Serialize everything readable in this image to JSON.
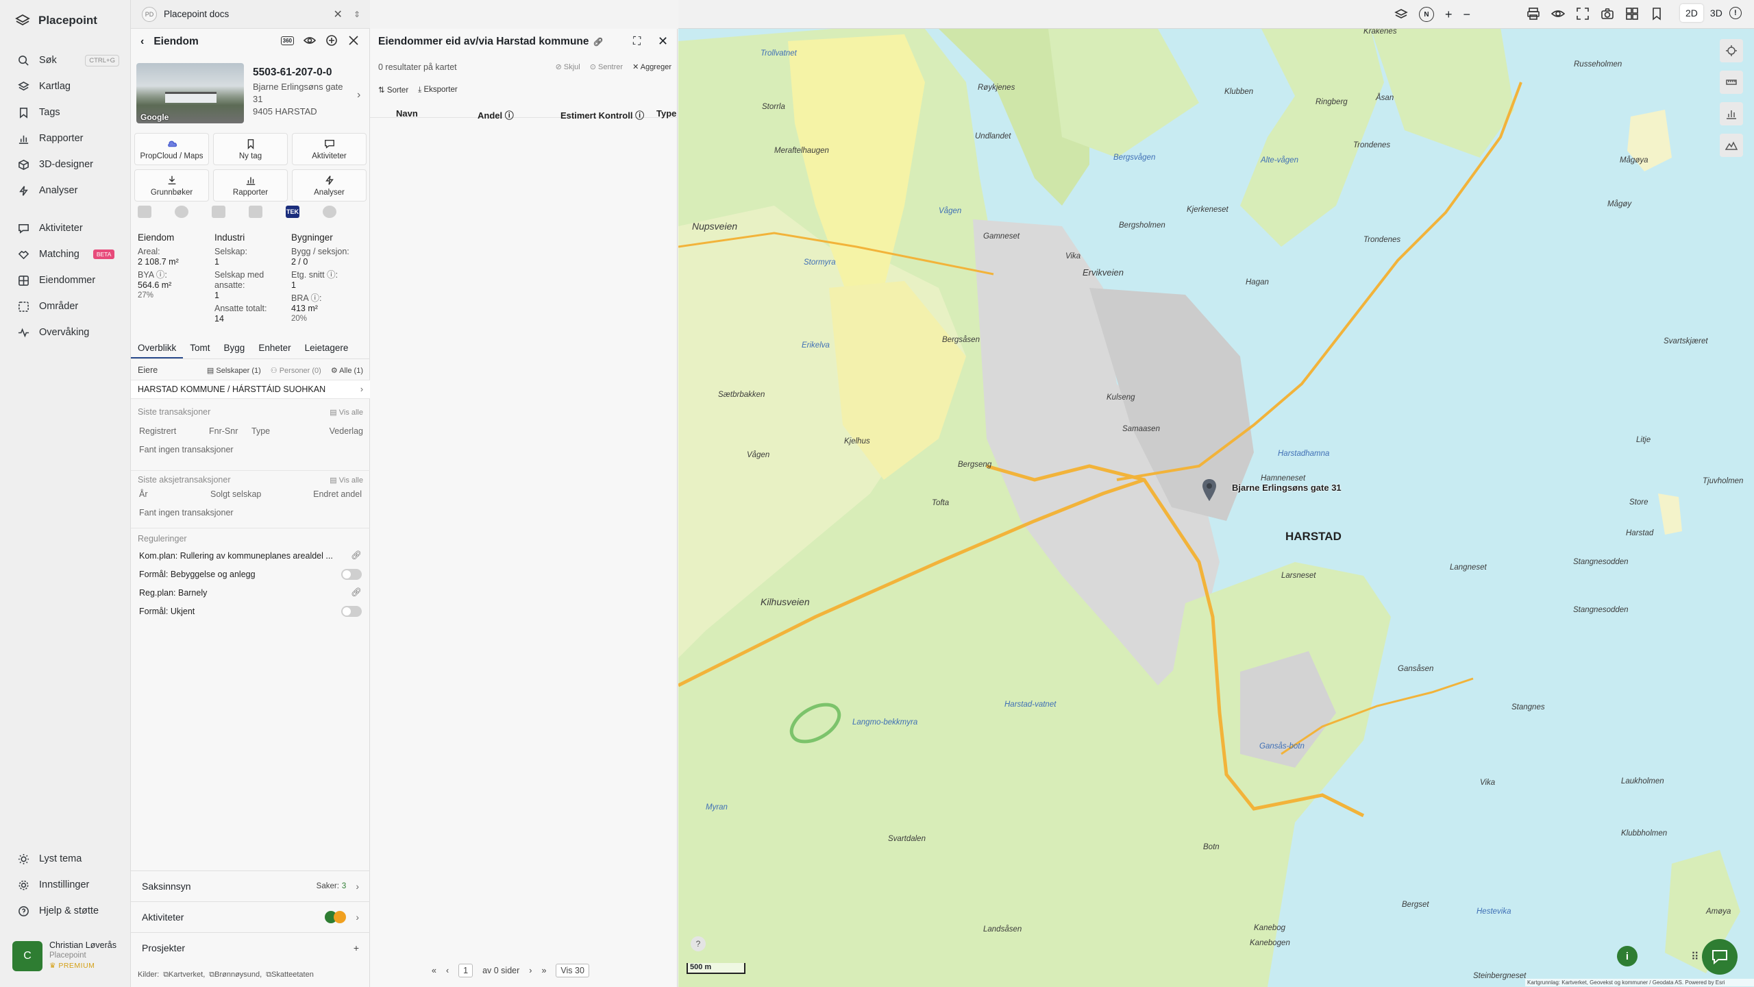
{
  "app": {
    "name": "Placepoint"
  },
  "nav": {
    "search": "Søk",
    "search_shortcut": "CTRL+G",
    "map_layers": "Kartlag",
    "tags": "Tags",
    "reports": "Rapporter",
    "designer3d": "3D-designer",
    "analyses": "Analyser",
    "activities": "Aktiviteter",
    "matching": "Matching",
    "matching_badge": "BETA",
    "properties": "Eiendommer",
    "areas": "Områder",
    "monitoring": "Overvåking",
    "theme": "Lyst tema",
    "settings": "Innstillinger",
    "help": "Hjelp & støtte"
  },
  "user": {
    "initial": "C",
    "name": "Christian Løverås",
    "org": "Placepoint",
    "plan": "PREMIUM"
  },
  "docs_tab": {
    "icon": "PD",
    "label": "Placepoint docs"
  },
  "property_panel": {
    "title": "Eiendom",
    "badge": "360",
    "photo_credit": "Google",
    "property_id": "5503-61-207-0-0",
    "address_line1": "Bjarne Erlingsøns gate 31",
    "address_line2": "9405 HARSTAD",
    "quick_actions": [
      "PropCloud / Maps",
      "Ny tag",
      "Aktiviteter",
      "Grunnbøker",
      "Rapporter",
      "Analyser"
    ],
    "source_icon_tek": "TEK",
    "stats": {
      "eiendom": {
        "heading": "Eiendom",
        "area_label": "Areal:",
        "area_value": "2 108.7 m²",
        "bya_label": "BYA ⓘ:",
        "bya_value": "564.6 m²",
        "bya_pct": "27%"
      },
      "industri": {
        "heading": "Industri",
        "companies_label": "Selskap:",
        "companies_value": "1",
        "with_employees_label": "Selskap med ansatte:",
        "with_employees_value": "1",
        "employees_label": "Ansatte totalt:",
        "employees_value": "14"
      },
      "bygninger": {
        "heading": "Bygninger",
        "bygg_label": "Bygg / seksjon:",
        "bygg_value": "2 / 0",
        "etg_label": "Etg. snitt ⓘ:",
        "etg_value": "1",
        "bra_label": "BRA ⓘ:",
        "bra_value": "413 m²",
        "bra_pct": "20%"
      }
    },
    "tabs": [
      "Overblikk",
      "Tomt",
      "Bygg",
      "Enheter",
      "Leietagere"
    ],
    "owners": {
      "label": "Eiere",
      "companies": "Selskaper (1)",
      "persons": "Personer (0)",
      "all": "Alle (1)",
      "owner_name": "HARSTAD KOMMUNE / HÁRSTTÁID SUOHKAN"
    },
    "transactions": {
      "title": "Siste transaksjoner",
      "see_all": "Vis alle",
      "cols": [
        "Registrert",
        "Fnr-Snr",
        "Type",
        "Vederlag"
      ],
      "empty": "Fant ingen transaksjoner"
    },
    "share_transactions": {
      "title": "Siste aksjetransaksjoner",
      "see_all": "Vis alle",
      "cols": [
        "År",
        "Solgt selskap",
        "Endret andel"
      ],
      "empty": "Fant ingen transaksjoner"
    },
    "regulations": {
      "title": "Reguleringer",
      "items": [
        "Kom.plan: Rullering av kommuneplanes arealdel ...",
        "Formål: Bebyggelse og anlegg",
        "Reg.plan: Barnely",
        "Formål: Ukjent"
      ]
    },
    "case_insight": {
      "label": "Saksinnsyn",
      "count_label": "Saker:",
      "count": "3"
    },
    "activities": {
      "label": "Aktiviteter"
    },
    "projects": {
      "label": "Prosjekter",
      "add": "+"
    },
    "sources": {
      "label": "Kilder:",
      "items": [
        "Kartverket",
        "Brønnøysund",
        "Skatteetaten"
      ]
    }
  },
  "owned_panel": {
    "title": "Eiendommer eid av/via Harstad kommune",
    "result_text": "0 resultater på kartet",
    "hide": "Skjul",
    "center": "Sentrer",
    "aggregate": "Aggreger",
    "sort": "Sorter",
    "export": "Eksporter",
    "columns": [
      "Navn",
      "Andel ⓘ",
      "Estimert Kontroll ⓘ",
      "Type"
    ],
    "pager": {
      "page": "1",
      "of_pages": "av 0 sider",
      "per_page": "Vis 30"
    }
  },
  "map": {
    "mode_2d": "2D",
    "mode_3d": "3D",
    "marker_label": "Bjarne Erlingsøns gate 31",
    "town": "HARSTAD",
    "scale": "500 m",
    "attribution": "Kartgrunnlag: Kartverket, Geovekst og kommuner / Geodata AS. Powered by Esri",
    "labels": [
      "Trollvatnet",
      "Krakenes",
      "Klubben",
      "Ringberg",
      "Åsan",
      "Russeholmen",
      "Røykjenes",
      "Undlandet",
      "Storrla",
      "Meraftelhaugen",
      "Bergsvågen",
      "Alte-vågen",
      "Trondenes",
      "Mågøya",
      "Mågøy",
      "Vågen",
      "Nupsveien",
      "Stormyra",
      "Gamneset",
      "Vika",
      "Ervikveien",
      "Kjerkeneset",
      "Bergsholmen",
      "Trondenes",
      "Bergsåsen",
      "Erikelva",
      "Hagan",
      "Kulseng",
      "Samaasen",
      "Sætbrbakken",
      "Kjelhus",
      "Vågen",
      "Bergseng",
      "Tofta",
      "Harstadhamna",
      "Hamneneset",
      "Harstad",
      "Tjuvholmen",
      "Store",
      "Litje",
      "Svartskjæret",
      "Kilhusveien",
      "Larsneset",
      "Langneset",
      "Stangnesodden",
      "Stangnesodden",
      "Gansåsen",
      "Stangnes",
      "Myran",
      "Harstad-vatnet",
      "Langmo-bekkmyra",
      "Gansås-botn",
      "Svartdalen",
      "Landsåsen",
      "Laukholmen",
      "Klubbholmen",
      "Vika",
      "Bergset",
      "Amøya",
      "Hestevika",
      "Steinbergneset",
      "Kanebogen",
      "Kanebog",
      "Botn"
    ]
  }
}
